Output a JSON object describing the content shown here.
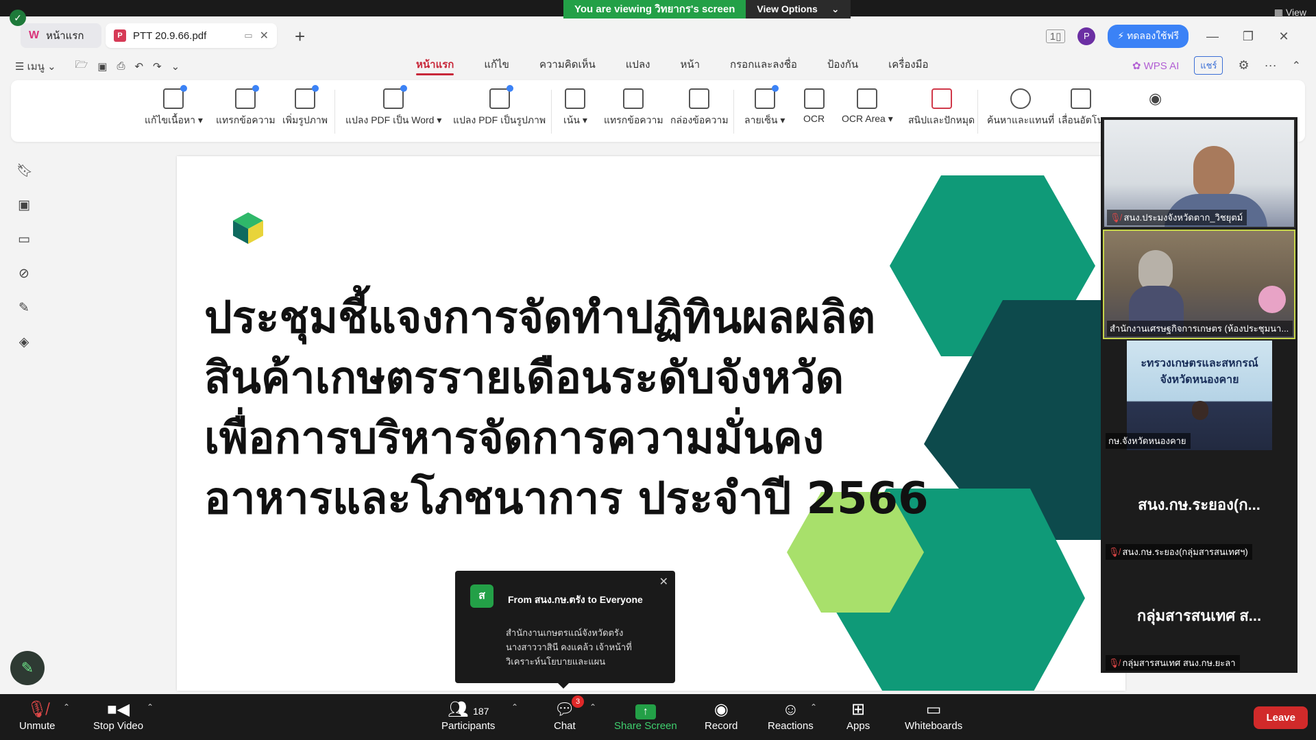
{
  "zoom": {
    "viewing_text": "You are viewing วิทยากร's screen",
    "view_options_label": "View Options",
    "view_label": "View",
    "bottom": {
      "unmute": "Unmute",
      "stop_video": "Stop Video",
      "participants": "Participants",
      "participants_count": "187",
      "chat": "Chat",
      "chat_badge": "3",
      "share_screen": "Share Screen",
      "record": "Record",
      "reactions": "Reactions",
      "apps": "Apps",
      "whiteboards": "Whiteboards",
      "leave": "Leave"
    },
    "chat_popup": {
      "avatar_letter": "ส",
      "from": "From สนง.กษ.ตรัง to Everyone",
      "line1": "สำนักงานเกษตรแณ์จังหวัดตรัง",
      "line2": "นางสาววาสินี  คงแคล้ว เจ้าหน้าที่",
      "line3": "วิเคราะห์นโยบายและแผน"
    },
    "gallery": [
      {
        "name": "สนง.ประมงจังหวัดตาก_วิชยุตม์",
        "muted": true
      },
      {
        "name": "สำนักงานเศรษฐกิจการเกษตร (ห้องประชุมนา...",
        "muted": false
      },
      {
        "name": "กษ.จังหวัดหนองคาย",
        "muted": false,
        "overlay_line1": "ะทรวงเกษตรและสหกรณ์",
        "overlay_line2": "จังหวัดหนองคาย"
      },
      {
        "name": "สนง.กษ.ระยอง(กลุ่มสารสนเทศฯ)",
        "muted": true,
        "big": "สนง.กษ.ระยอง(ก..."
      },
      {
        "name": "กลุ่มสารสนเทศ สนง.กษ.ยะลา",
        "muted": true,
        "big": "กลุ่มสารสนเทศ ส..."
      }
    ]
  },
  "wps": {
    "tabs": [
      {
        "label": "หน้าแรก"
      },
      {
        "label": "PTT 20.9.66.pdf"
      }
    ],
    "trial_button": "ทดลองใช้ฟรี",
    "avatar_letter": "P",
    "menu_label": "เมนู",
    "nav_tabs": [
      "หน้าแรก",
      "แก้ไข",
      "ความคิดเห็น",
      "แปลง",
      "หน้า",
      "กรอกและลงชื่อ",
      "ป้องกัน",
      "เครื่องมือ"
    ],
    "wps_ai": "WPS AI",
    "share": "แชร์",
    "ribbon": [
      {
        "label": "แก้ไขเนื้อหา ▾",
        "icon": "edit-content-icon"
      },
      {
        "label": "แทรกข้อความ",
        "icon": "insert-text-icon"
      },
      {
        "label": "เพิ่มรูปภาพ",
        "icon": "add-image-icon"
      },
      {
        "label": "แปลง PDF เป็น Word ▾",
        "icon": "pdf-to-word-icon"
      },
      {
        "label": "แปลง PDF เป็นรูปภาพ",
        "icon": "pdf-to-image-icon"
      },
      {
        "label": "เน้น ▾",
        "icon": "highlight-icon"
      },
      {
        "label": "แทรกข้อความ",
        "icon": "insert-comment-icon"
      },
      {
        "label": "กล่องข้อความ",
        "icon": "text-box-icon"
      },
      {
        "label": "ลายเซ็น ▾",
        "icon": "signature-icon"
      },
      {
        "label": "OCR",
        "icon": "ocr-icon"
      },
      {
        "label": "OCR Area ▾",
        "icon": "ocr-area-icon"
      },
      {
        "label": "สนิปและปักหมุด",
        "icon": "snip-pin-icon"
      },
      {
        "label": "ค้นหาและแทนที่",
        "icon": "find-replace-icon"
      },
      {
        "label": "เลื่อนอัตโน",
        "icon": "auto-scroll-icon"
      }
    ]
  },
  "slide": {
    "title_lines": [
      "ประชุมชี้แจงการจัดทำปฏิทินผลผลิต",
      "สินค้าเกษตรรายเดือนระดับจังหวัด",
      "เพื่อการบริหารจัดการความมั่นคง",
      "อาหารและโภชนาการ ประจำปี 2566"
    ]
  },
  "colors": {
    "hex_teal": "#0f9a78",
    "hex_dark": "#0d4a4c",
    "hex_light": "#a8e06b",
    "zoom_green": "#23a047",
    "leave_red": "#d12a2a"
  }
}
